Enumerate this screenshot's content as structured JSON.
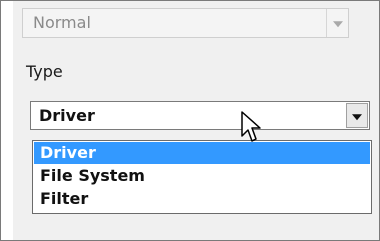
{
  "priority_combo": {
    "value": "Normal",
    "enabled": false
  },
  "type_field": {
    "label": "Type",
    "value": "Driver",
    "options": [
      "Driver",
      "File System",
      "Filter"
    ],
    "highlighted_option": "Driver"
  },
  "colors": {
    "selection": "#3399ff",
    "selection_text": "#ffffff"
  }
}
